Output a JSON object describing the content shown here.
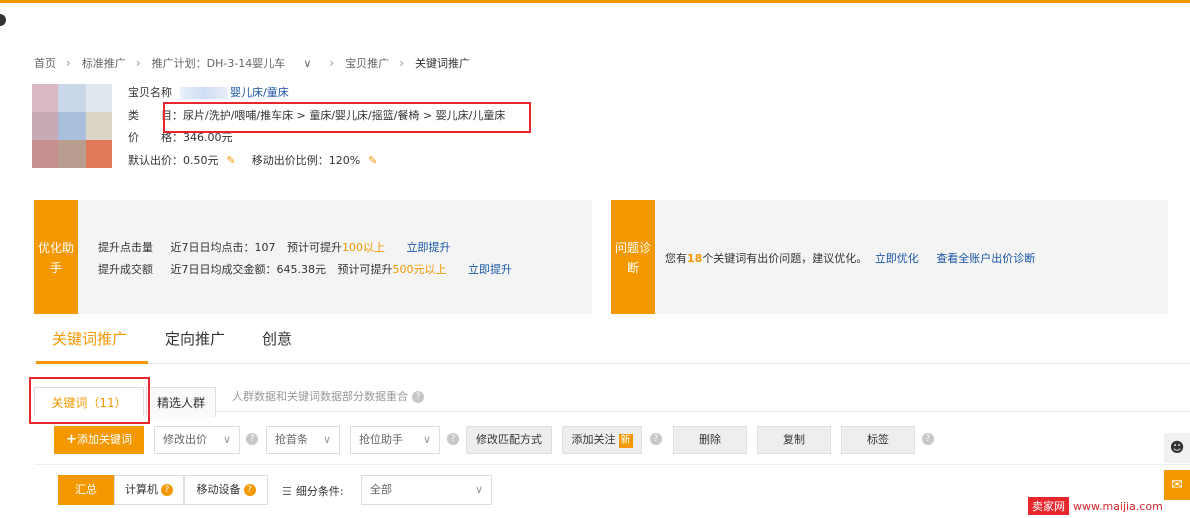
{
  "breadcrumb": {
    "home": "首页",
    "standard": "标准推广",
    "plan": "推广计划：DH-3-14婴儿车",
    "item": "宝贝推广",
    "current": "关键词推广",
    "plan_dropdown_icon": "chevron-down"
  },
  "product": {
    "name_label": "宝贝名称",
    "name_value": "婴儿床/童床",
    "category_label": "类　　目：",
    "category_value": "尿片/洗护/喂哺/推车床 > 童床/婴儿床/摇篮/餐椅 > 婴儿床/儿童床",
    "price_label": "价　　格：",
    "price_value": "346.00元",
    "default_bid_label": "默认出价：",
    "default_bid_value": "0.50元",
    "mobile_ratio_label": "移动出价比例：",
    "mobile_ratio_value": "120%"
  },
  "optimize": {
    "tag": "优化助手",
    "row1_label": "提升点击量",
    "row1_stat": "近7日日均点击：107",
    "row1_est_prefix": "预计可提升",
    "row1_est_value": "100以上",
    "row1_link": "立即提升",
    "row2_label": "提升成交额",
    "row2_stat": "近7日日均成交金额：645.38元",
    "row2_est_prefix": "预计可提升",
    "row2_est_value": "500元以上",
    "row2_link": "立即提升"
  },
  "diagnosis": {
    "tag": "问题诊断",
    "text_prefix": "您有",
    "count": "18",
    "text_suffix": "个关键词有出价问题，建议优化。",
    "link1": "立即优化",
    "link2": "查看全账户出价诊断"
  },
  "tabs": [
    "关键词推广",
    "定向推广",
    "创意"
  ],
  "subtabs": {
    "keywords": "关键词（11）",
    "crowd": "精选人群",
    "note": "人群数据和关键词数据部分数据重合"
  },
  "toolbar": {
    "add_keyword": "添加关键词",
    "modify_bid": "修改出价",
    "first_position": "抢首条",
    "rank_helper": "抢位助手",
    "match_mode": "修改匹配方式",
    "add_follow": "添加关注",
    "new_badge": "新",
    "delete": "删除",
    "copy": "复制",
    "tag": "标签"
  },
  "filter": {
    "summary": "汇总",
    "computer": "计算机",
    "mobile": "移动设备",
    "condition_label": "细分条件:",
    "condition_value": "全部"
  },
  "watermark": {
    "brand": "卖家网",
    "url": "www.maijia.com"
  },
  "colors": {
    "accent": "#f39800",
    "link": "#1a55a5",
    "highlight_box": "#e8262d"
  }
}
